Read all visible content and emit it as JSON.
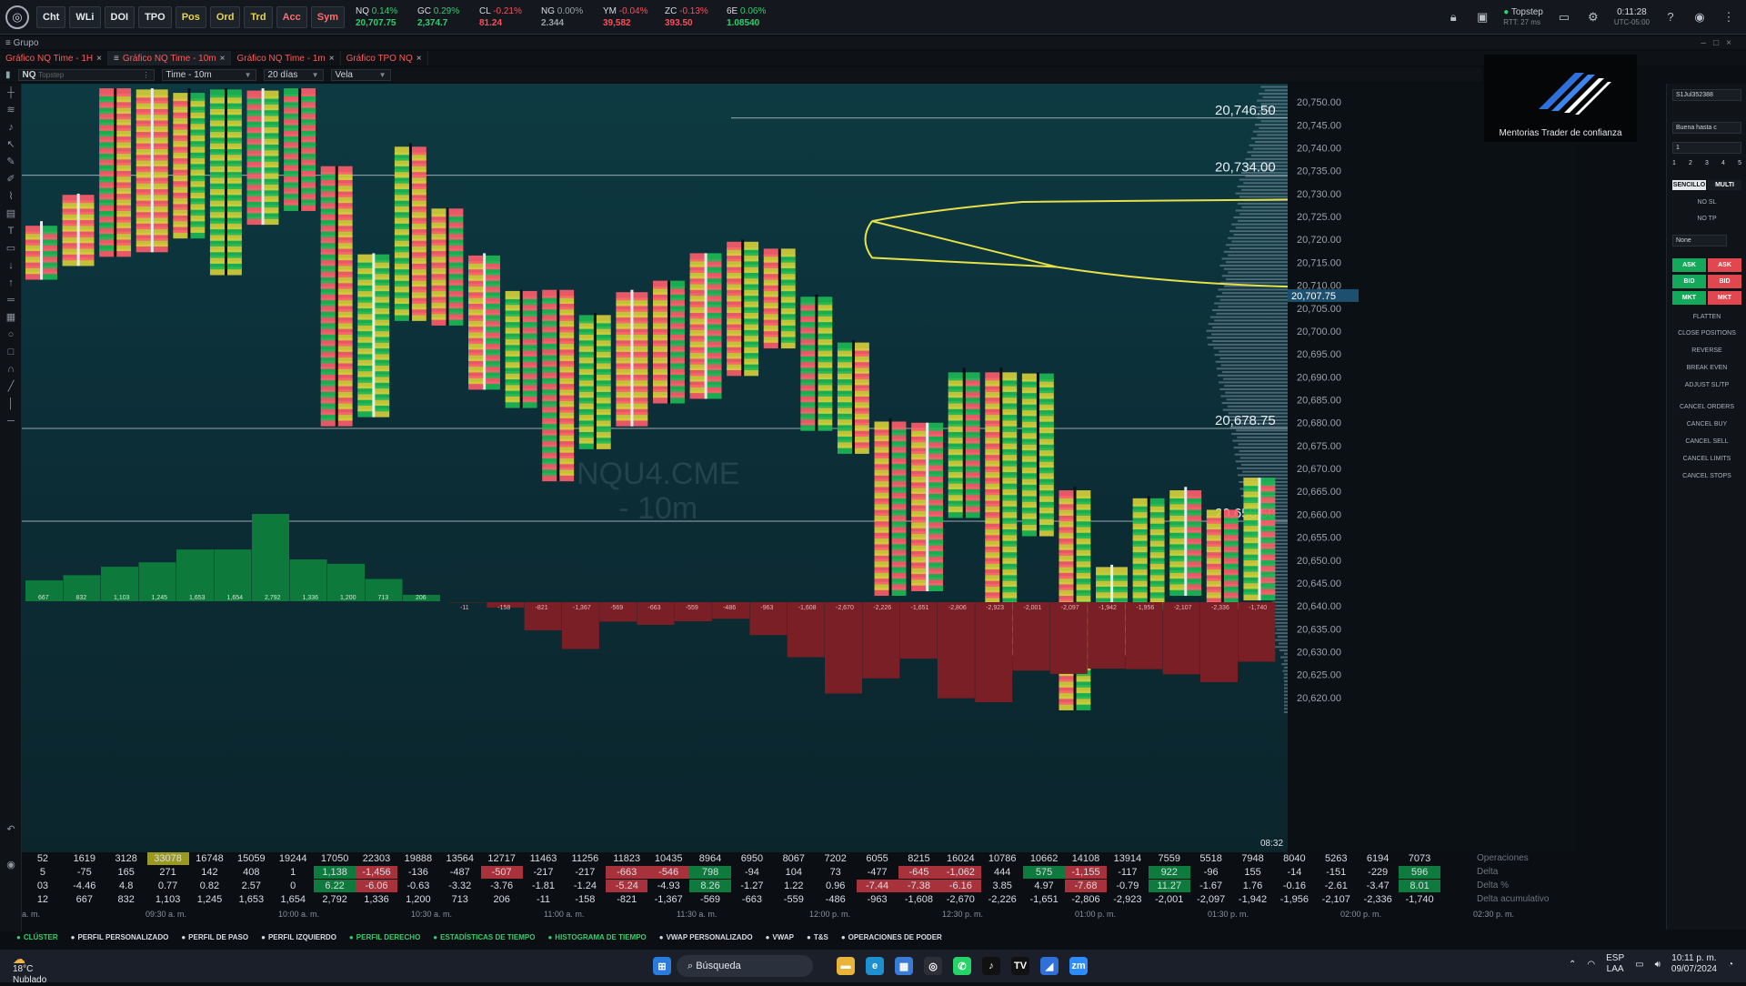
{
  "toolbar": {
    "buttons": [
      {
        "label": "Cht",
        "style": "normal"
      },
      {
        "label": "WLi",
        "style": "normal"
      },
      {
        "label": "DOI",
        "style": "normal"
      },
      {
        "label": "TPO",
        "style": "normal"
      },
      {
        "label": "Pos",
        "style": "yellow"
      },
      {
        "label": "Ord",
        "style": "yellow"
      },
      {
        "label": "Trd",
        "style": "yellow"
      },
      {
        "label": "Acc",
        "style": "red"
      },
      {
        "label": "Sym",
        "style": "red"
      }
    ],
    "tickers": [
      {
        "name": "NQ",
        "change": "0.14%",
        "price": "20,707.75",
        "dir": "up"
      },
      {
        "name": "GC",
        "change": "0.29%",
        "price": "2,374.7",
        "dir": "up"
      },
      {
        "name": "CL",
        "change": "-0.21%",
        "price": "81.24",
        "dir": "dn"
      },
      {
        "name": "NG",
        "change": "0.00%",
        "price": "2.344",
        "dir": "flat"
      },
      {
        "name": "YM",
        "change": "-0.04%",
        "price": "39,582",
        "dir": "dn"
      },
      {
        "name": "ZC",
        "change": "-0.13%",
        "price": "393.50",
        "dir": "dn"
      },
      {
        "name": "6E",
        "change": "0.06%",
        "price": "1.08540",
        "dir": "up"
      }
    ],
    "connection": {
      "name": "Topstep",
      "latency": "RTT: 27 ms"
    },
    "clock": {
      "time": "0:11:28",
      "zone": "UTC-05:00"
    }
  },
  "group": {
    "title": "Grupo"
  },
  "tabs": [
    {
      "label": "Gráfico NQ Time - 1H",
      "active": false
    },
    {
      "label": "Gráfico NQ Time - 10m",
      "active": true
    },
    {
      "label": "Gráfico NQ Time - 1m",
      "active": false
    },
    {
      "label": "Gráfico TPO NQ",
      "active": false
    }
  ],
  "chart_toolbar": {
    "symbol": "NQ",
    "symbol_hint": "Topstep",
    "interval": "Time - 10m",
    "range": "20 días",
    "style": "Vela"
  },
  "chart": {
    "watermark_line1": "NQU4.CME",
    "watermark_line2": "- 10m",
    "brand": "Mentorias Trader de confianza",
    "current_price": "20,707.75",
    "level_labels": [
      "20,746.50",
      "20,734.00",
      "20,678.75",
      "20,658.50"
    ],
    "countdown": "08:32",
    "colors": {
      "bull": "#1db954",
      "bear": "#ff5d6c",
      "neutral": "#d6d23a",
      "profile": "#7f8fa0",
      "va_line": "#e6e04a"
    }
  },
  "chart_data": {
    "type": "bar",
    "price_axis": [
      "20,750.00",
      "20,745.00",
      "20,740.00",
      "20,735.00",
      "20,730.00",
      "20,725.00",
      "20,720.00",
      "20,715.00",
      "20,710.00",
      "20,705.00",
      "20,700.00",
      "20,695.00",
      "20,690.00",
      "20,685.00",
      "20,680.00",
      "20,675.00",
      "20,670.00",
      "20,665.00",
      "20,660.00",
      "20,655.00",
      "20,650.00",
      "20,645.00",
      "20,640.00",
      "20,635.00",
      "20,630.00",
      "20,625.00",
      "20,620.00"
    ],
    "ylim": [
      20617,
      20754
    ],
    "candles": [
      {
        "hi": 20723,
        "lo": 20712,
        "dir": "up"
      },
      {
        "hi": 20729,
        "lo": 20715,
        "dir": "up"
      },
      {
        "hi": 20752,
        "lo": 20717,
        "dir": "dn"
      },
      {
        "hi": 20752,
        "lo": 20718,
        "dir": "up"
      },
      {
        "hi": 20752,
        "lo": 20721,
        "dir": "dn"
      },
      {
        "hi": 20752,
        "lo": 20713,
        "dir": "dn"
      },
      {
        "hi": 20752,
        "lo": 20724,
        "dir": "up"
      },
      {
        "hi": 20752,
        "lo": 20727,
        "dir": "dn"
      },
      {
        "hi": 20735,
        "lo": 20680,
        "dir": "dn"
      },
      {
        "hi": 20716,
        "lo": 20682,
        "dir": "up"
      },
      {
        "hi": 20740,
        "lo": 20703,
        "dir": "dn"
      },
      {
        "hi": 20726,
        "lo": 20702,
        "dir": "dn"
      },
      {
        "hi": 20716,
        "lo": 20688,
        "dir": "up"
      },
      {
        "hi": 20708,
        "lo": 20684,
        "dir": "dn"
      },
      {
        "hi": 20708,
        "lo": 20668,
        "dir": "dn"
      },
      {
        "hi": 20703,
        "lo": 20675,
        "dir": "dn"
      },
      {
        "hi": 20708,
        "lo": 20680,
        "dir": "up"
      },
      {
        "hi": 20710,
        "lo": 20685,
        "dir": "dn"
      },
      {
        "hi": 20716,
        "lo": 20686,
        "dir": "up"
      },
      {
        "hi": 20719,
        "lo": 20691,
        "dir": "dn"
      },
      {
        "hi": 20717,
        "lo": 20697,
        "dir": "dn"
      },
      {
        "hi": 20707,
        "lo": 20679,
        "dir": "dn"
      },
      {
        "hi": 20697,
        "lo": 20674,
        "dir": "dn"
      },
      {
        "hi": 20680,
        "lo": 20643,
        "dir": "dn"
      },
      {
        "hi": 20679,
        "lo": 20644,
        "dir": "up"
      },
      {
        "hi": 20691,
        "lo": 20660,
        "dir": "dn"
      },
      {
        "hi": 20691,
        "lo": 20630,
        "dir": "dn"
      },
      {
        "hi": 20690,
        "lo": 20656,
        "dir": "dn"
      },
      {
        "hi": 20665,
        "lo": 20618,
        "dir": "dn"
      },
      {
        "hi": 20648,
        "lo": 20630,
        "dir": "up"
      },
      {
        "hi": 20663,
        "lo": 20640,
        "dir": "dn"
      },
      {
        "hi": 20665,
        "lo": 20643,
        "dir": "up"
      },
      {
        "hi": 20660,
        "lo": 20640,
        "dir": "dn"
      },
      {
        "hi": 20667,
        "lo": 20642,
        "dir": "up"
      }
    ],
    "bars": {
      "volume": [
        667,
        832,
        1103,
        1245,
        1653,
        1654,
        2792,
        1336,
        1200,
        713,
        206
      ],
      "delta_cum": [
        -11,
        -158,
        -821,
        -1367,
        -569,
        -663,
        -559,
        -486,
        -963,
        -1608,
        -2670,
        -2226,
        -1651,
        -2806,
        -2923,
        -2001,
        -2097,
        -1942,
        -1956,
        -2107,
        -2336,
        -1740
      ]
    },
    "stats": {
      "labels": [
        "Operaciones",
        "Delta",
        "Delta %",
        "Delta acumulativo"
      ],
      "trades": [
        "52",
        "1619",
        "3128",
        "33078",
        "16748",
        "15059",
        "19244",
        "17050",
        "22303",
        "19888",
        "13564",
        "12717",
        "11463",
        "11256",
        "11823",
        "10435",
        "8964",
        "6950",
        "8067",
        "7202",
        "6055",
        "8215",
        "16024",
        "10786",
        "10662",
        "14108",
        "13914",
        "7559",
        "5518",
        "7948",
        "8040",
        "5263",
        "6194",
        "7073"
      ],
      "delta": [
        "5",
        "-75",
        "165",
        "271",
        "142",
        "408",
        "1",
        "1,138",
        "-1,456",
        "-136",
        "-487",
        "-507",
        "-217",
        "-217",
        "-663",
        "-546",
        "798",
        "-94",
        "104",
        "73",
        "-477",
        "-645",
        "-1,062",
        "444",
        "575",
        "-1,155",
        "-117",
        "922",
        "-96",
        "155",
        "-14",
        "-151",
        "-229",
        "596"
      ],
      "delta_pct": [
        "03",
        "-4.46",
        "4.8",
        "0.77",
        "0.82",
        "2.57",
        "0",
        "6.22",
        "-6.06",
        "-0.63",
        "-3.32",
        "-3.76",
        "-1.81",
        "-1.24",
        "-5.24",
        "-4.93",
        "8.26",
        "-1.27",
        "1.22",
        "0.96",
        "-7.44",
        "-7.38",
        "-6.16",
        "3.85",
        "4.97",
        "-7.68",
        "-0.79",
        "11.27",
        "-1.67",
        "1.76",
        "-0.16",
        "-2.61",
        "-3.47",
        "8.01"
      ],
      "delta_cum": [
        "12",
        "667",
        "832",
        "1,103",
        "1,245",
        "1,653",
        "1,654",
        "2,792",
        "1,336",
        "1,200",
        "713",
        "206",
        "-11",
        "-158",
        "-821",
        "-1,367",
        "-569",
        "-663",
        "-559",
        "-486",
        "-963",
        "-1,608",
        "-2,670",
        "-2,226",
        "-1,651",
        "-2,806",
        "-2,923",
        "-2,001",
        "-2,097",
        "-1,942",
        "-1,956",
        "-2,107",
        "-2,336",
        "-1,740"
      ]
    },
    "time_axis": [
      "a. m.",
      "09:30 a. m.",
      "10:00 a. m.",
      "10:30 a. m.",
      "11:00 a. m.",
      "11:30 a. m.",
      "12:00 p. m.",
      "12:30 p. m.",
      "01:00 p. m.",
      "01:30 p. m.",
      "02:00 p. m.",
      "02:30 p. m."
    ]
  },
  "indicators": [
    {
      "label": "CLÚSTER",
      "on": true
    },
    {
      "label": "PERFIL PERSONALIZADO",
      "on": false
    },
    {
      "label": "PERFIL DE PASO",
      "on": false
    },
    {
      "label": "PERFIL IZQUIERDO",
      "on": false
    },
    {
      "label": "PERFIL DERECHO",
      "on": true
    },
    {
      "label": "ESTADÍSTICAS DE TIEMPO",
      "on": true
    },
    {
      "label": "HISTOGRAMA DE TIEMPO",
      "on": true
    },
    {
      "label": "VWAP PERSONALIZADO",
      "on": false
    },
    {
      "label": "VWAP",
      "on": false
    },
    {
      "label": "T&S",
      "on": false
    },
    {
      "label": "OPERACIONES DE PODER",
      "on": false
    }
  ],
  "panel": {
    "account": "S1Jul352388",
    "tif": "Buena hasta c",
    "qty": "1",
    "presets": [
      "1",
      "2",
      "3",
      "4",
      "5"
    ],
    "mode_single": "SENCILLO",
    "mode_multi": "MULTI",
    "no_sl": "NO SL",
    "no_tp": "NO TP",
    "atm": "None",
    "buy_ask": "ASK",
    "sell_ask": "ASK",
    "buy_bid": "BID",
    "sell_bid": "BID",
    "buy_mkt": "MKT",
    "sell_mkt": "MKT",
    "actions": [
      "FLATTEN",
      "CLOSE POSITIONS",
      "REVERSE",
      "BREAK EVEN",
      "ADJUST SL/TP",
      "CANCEL ORDERS",
      "CANCEL BUY",
      "CANCEL SELL",
      "CANCEL LIMITS",
      "CANCEL STOPS"
    ]
  },
  "taskbar": {
    "temp": "18°C",
    "weather": "Nublado",
    "search": "Búsqueda",
    "lang": "ESP",
    "lang2": "LAA",
    "time": "10:11 p. m.",
    "date": "09/07/2024"
  }
}
